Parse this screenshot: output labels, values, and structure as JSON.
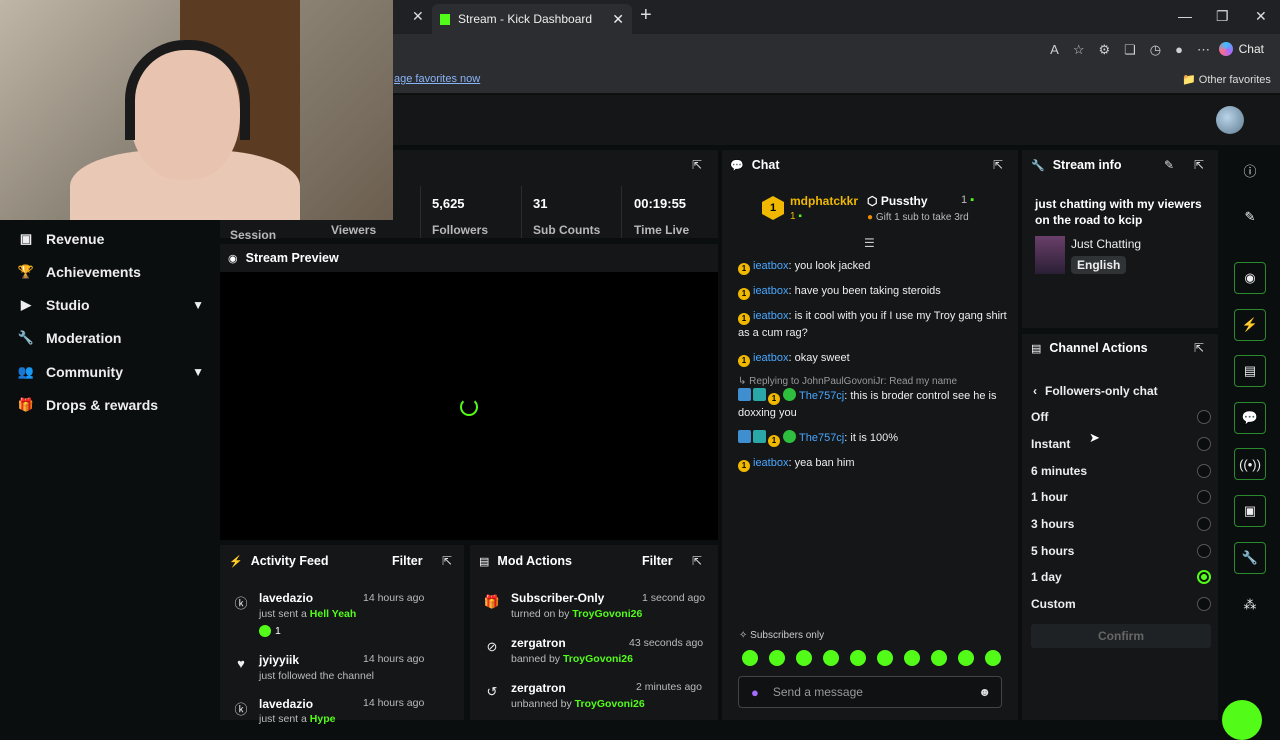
{
  "browser": {
    "tab_title": "Stream - Kick Dashboard",
    "fav_link": "age favorites now",
    "other_favorites": "Other favorites",
    "copilot_label": "Chat"
  },
  "sidebar": {
    "items": [
      {
        "label": "Revenue",
        "icon": "chart-icon",
        "expandable": false
      },
      {
        "label": "Achievements",
        "icon": "trophy-icon",
        "expandable": false
      },
      {
        "label": "Studio",
        "icon": "camera-icon",
        "expandable": true
      },
      {
        "label": "Moderation",
        "icon": "wrench-icon",
        "expandable": false
      },
      {
        "label": "Community",
        "icon": "people-icon",
        "expandable": true
      },
      {
        "label": "Drops & rewards",
        "icon": "gift-icon",
        "expandable": false
      }
    ]
  },
  "stats": {
    "session_label": "Session",
    "viewers_label": "Viewers",
    "followers_value": "5,625",
    "followers_label": "Followers",
    "subs_value": "31",
    "subs_label": "Sub Counts",
    "time_value": "00:19:55",
    "time_label": "Time Live"
  },
  "preview": {
    "title": "Stream Preview"
  },
  "activity": {
    "title": "Activity Feed",
    "filter": "Filter",
    "items": [
      {
        "name": "lavedazio",
        "pre": "just sent a ",
        "highlight": "Hell Yeah",
        "extra": "1",
        "time": "14 hours ago"
      },
      {
        "name": "jyiyyiik",
        "pre": "just followed the channel",
        "highlight": "",
        "extra": "",
        "time": "14 hours ago"
      },
      {
        "name": "lavedazio",
        "pre": "just sent a ",
        "highlight": "Hype",
        "extra": "",
        "time": "14 hours ago"
      }
    ]
  },
  "mod": {
    "title": "Mod Actions",
    "filter": "Filter",
    "items": [
      {
        "name": "Subscriber-Only",
        "pre": "turned on by ",
        "by": "TroyGovoni26",
        "time": "1 second ago"
      },
      {
        "name": "zergatron",
        "pre": "banned by ",
        "by": "TroyGovoni26",
        "time": "43 seconds ago"
      },
      {
        "name": "zergatron",
        "pre": "unbanned by ",
        "by": "TroyGovoni26",
        "time": "2 minutes ago"
      }
    ]
  },
  "chat": {
    "title": "Chat",
    "pinned": [
      {
        "rank": "1",
        "name": "mdphatckkr",
        "count": "1"
      },
      {
        "name": "Pussthy",
        "count": "1",
        "sub": "Gift 1 sub to take 3rd"
      }
    ],
    "messages": [
      {
        "user": "ieatbox",
        "text": ": you look jacked"
      },
      {
        "user": "ieatbox",
        "text": ": have you been taking steroids"
      },
      {
        "user": "ieatbox",
        "text": ": is it cool with you if I use my Troy gang shirt as a cum rag?"
      },
      {
        "user": "ieatbox",
        "text": ": okay sweet"
      },
      {
        "reply": "Replying to JohnPaulGovoniJr: Read my name",
        "user": "The757cj",
        "text": ": this is broder control see he is doxxing you"
      },
      {
        "user": "The757cj",
        "text": ": it is 100%"
      },
      {
        "user": "ieatbox",
        "text": ": yea ban him"
      }
    ],
    "mode": "Subscribers only",
    "placeholder": "Send a message"
  },
  "stream_info": {
    "title": "Stream info",
    "stream_title": "just chatting with my viewers on the road to kcip",
    "category": "Just Chatting",
    "language": "English"
  },
  "channel_actions": {
    "title": "Channel Actions",
    "subtitle": "Followers-only chat",
    "options": [
      "Off",
      "Instant",
      "6 minutes",
      "1 hour",
      "3 hours",
      "5 hours",
      "1 day",
      "Custom"
    ],
    "selected": "1 day",
    "confirm": "Confirm"
  },
  "colors": {
    "accent": "#53fc18",
    "username": "#4aa8ff",
    "panel": "#141618"
  }
}
